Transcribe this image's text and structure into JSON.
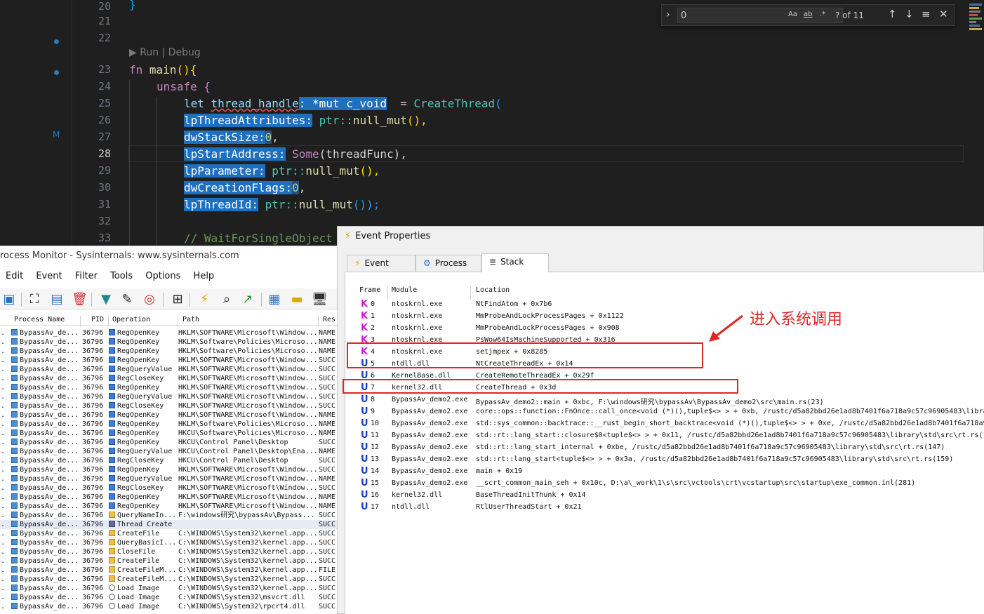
{
  "editor": {
    "line_numbers": [
      "20",
      "21",
      "22",
      "23",
      "24",
      "25",
      "26",
      "27",
      "28",
      "29",
      "30",
      "31",
      "32",
      "33"
    ],
    "active_line": "28",
    "codelens": "▶ Run | Debug",
    "gutter_marker": "M",
    "code": {
      "l20": "}",
      "l23_kw": "fn",
      "l23_fn": "main",
      "l23_rest": "(){",
      "l24_kw": "unsafe",
      "l24_rest": " {",
      "l25_let": "let",
      "l25_var": "thread_handle",
      "l25_type": ": *mut c_void",
      "l25_eq": "  = ",
      "l25_fn": "CreateThread",
      "l25_paren": "(",
      "l26_param": "lpThreadAttributes:",
      "l26_val_ns": " ptr::",
      "l26_val_fn": "null_mut",
      "l26_end": "(),",
      "l27_param": "dwStackSize:",
      "l27_num": "0",
      "l27_end": ",",
      "l28_param": "lpStartAddress:",
      "l28_some": " Some",
      "l28_arg": "(threadFunc)",
      "l28_end": ",",
      "l29_param": "lpParameter:",
      "l29_val_ns": " ptr::",
      "l29_val_fn": "null_mut",
      "l29_end": "(),",
      "l30_param": "dwCreationFlags:",
      "l30_num": "0",
      "l30_end": ",",
      "l31_param": "lpThreadId:",
      "l31_val_ns": " ptr::",
      "l31_val_fn": "null_mut",
      "l31_end": "());",
      "l33_comment": "// WaitForSingleObject"
    },
    "find": {
      "value": "0",
      "case_label": "Aa",
      "word_label": "ab",
      "regex_label": ".*",
      "count": "? of 11"
    }
  },
  "procmon": {
    "title": "rocess Monitor - Sysinternals: www.sysinternals.com",
    "menu": [
      "Edit",
      "Event",
      "Filter",
      "Tools",
      "Options",
      "Help"
    ],
    "columns": [
      "Process Name",
      "PID",
      "Operation",
      "Path",
      "Res"
    ],
    "rows": [
      {
        "proc": "BypassAv_de...",
        "pid": "36796",
        "op": "RegOpenKey",
        "path": "HKLM\\SOFTWARE\\Microsoft\\Window...",
        "res": "NAME",
        "kind": "reg"
      },
      {
        "proc": "BypassAv_de...",
        "pid": "36796",
        "op": "RegOpenKey",
        "path": "HKLM\\Software\\Policies\\Microso...",
        "res": "NAME",
        "kind": "reg"
      },
      {
        "proc": "BypassAv_de...",
        "pid": "36796",
        "op": "RegOpenKey",
        "path": "HKLM\\Software\\Policies\\Microso...",
        "res": "NAME",
        "kind": "reg"
      },
      {
        "proc": "BypassAv_de...",
        "pid": "36796",
        "op": "RegOpenKey",
        "path": "HKLM\\SOFTWARE\\Microsoft\\Window...",
        "res": "SUCC",
        "kind": "reg"
      },
      {
        "proc": "BypassAv_de...",
        "pid": "36796",
        "op": "RegQueryValue",
        "path": "HKLM\\SOFTWARE\\Microsoft\\Window...",
        "res": "SUCC",
        "kind": "reg"
      },
      {
        "proc": "BypassAv_de...",
        "pid": "36796",
        "op": "RegCloseKey",
        "path": "HKLM\\SOFTWARE\\Microsoft\\Window...",
        "res": "SUCC",
        "kind": "reg"
      },
      {
        "proc": "BypassAv_de...",
        "pid": "36796",
        "op": "RegOpenKey",
        "path": "HKLM\\SOFTWARE\\Microsoft\\Window...",
        "res": "SUCC",
        "kind": "reg"
      },
      {
        "proc": "BypassAv_de...",
        "pid": "36796",
        "op": "RegQueryValue",
        "path": "HKLM\\SOFTWARE\\Microsoft\\Window...",
        "res": "SUCC",
        "kind": "reg"
      },
      {
        "proc": "BypassAv_de...",
        "pid": "36796",
        "op": "RegCloseKey",
        "path": "HKLM\\SOFTWARE\\Microsoft\\Window...",
        "res": "SUCC",
        "kind": "reg"
      },
      {
        "proc": "BypassAv_de...",
        "pid": "36796",
        "op": "RegOpenKey",
        "path": "HKLM\\SOFTWARE\\Microsoft\\Window...",
        "res": "NAME",
        "kind": "reg"
      },
      {
        "proc": "BypassAv_de...",
        "pid": "36796",
        "op": "RegOpenKey",
        "path": "HKLM\\Software\\Policies\\Microso...",
        "res": "NAME",
        "kind": "reg"
      },
      {
        "proc": "BypassAv_de...",
        "pid": "36796",
        "op": "RegOpenKey",
        "path": "HKCU\\Software\\Policies\\Microso...",
        "res": "NAME",
        "kind": "reg"
      },
      {
        "proc": "BypassAv_de...",
        "pid": "36796",
        "op": "RegOpenKey",
        "path": "HKCU\\Control Panel\\Desktop",
        "res": "SUCC",
        "kind": "reg"
      },
      {
        "proc": "BypassAv_de...",
        "pid": "36796",
        "op": "RegQueryValue",
        "path": "HKCU\\Control Panel\\Desktop\\Ena...",
        "res": "NAME",
        "kind": "reg"
      },
      {
        "proc": "BypassAv_de...",
        "pid": "36796",
        "op": "RegCloseKey",
        "path": "HKCU\\Control Panel\\Desktop",
        "res": "SUCC",
        "kind": "reg"
      },
      {
        "proc": "BypassAv_de...",
        "pid": "36796",
        "op": "RegOpenKey",
        "path": "HKLM\\SOFTWARE\\Microsoft\\Window...",
        "res": "SUCC",
        "kind": "reg"
      },
      {
        "proc": "BypassAv_de...",
        "pid": "36796",
        "op": "RegQueryValue",
        "path": "HKLM\\SOFTWARE\\Microsoft\\Window...",
        "res": "NAME",
        "kind": "reg"
      },
      {
        "proc": "BypassAv_de...",
        "pid": "36796",
        "op": "RegCloseKey",
        "path": "HKLM\\SOFTWARE\\Microsoft\\Window...",
        "res": "SUCC",
        "kind": "reg"
      },
      {
        "proc": "BypassAv_de...",
        "pid": "36796",
        "op": "RegOpenKey",
        "path": "HKLM\\SOFTWARE\\Microsoft\\Window...",
        "res": "NAME",
        "kind": "reg"
      },
      {
        "proc": "BypassAv_de...",
        "pid": "36796",
        "op": "RegOpenKey",
        "path": "HKLM\\SOFTWARE\\Microsoft\\Window...",
        "res": "NAME",
        "kind": "reg"
      },
      {
        "proc": "BypassAv_de...",
        "pid": "36796",
        "op": "QueryNameIn...",
        "path": "F:\\windows研究\\bypassAv\\Bypass...",
        "res": "SUCC",
        "kind": "file"
      },
      {
        "proc": "BypassAv_de...",
        "pid": "36796",
        "op": "Thread Create",
        "path": "",
        "res": "SUCC",
        "kind": "thread",
        "selected": true
      },
      {
        "proc": "BypassAv_de...",
        "pid": "36796",
        "op": "CreateFile",
        "path": "C:\\WINDOWS\\System32\\kernel.app...",
        "res": "SUCC",
        "kind": "file"
      },
      {
        "proc": "BypassAv_de...",
        "pid": "36796",
        "op": "QueryBasicI...",
        "path": "C:\\WINDOWS\\System32\\kernel.app...",
        "res": "SUCC",
        "kind": "file"
      },
      {
        "proc": "BypassAv_de...",
        "pid": "36796",
        "op": "CloseFile",
        "path": "C:\\WINDOWS\\System32\\kernel.app...",
        "res": "SUCC",
        "kind": "file"
      },
      {
        "proc": "BypassAv_de...",
        "pid": "36796",
        "op": "CreateFile",
        "path": "C:\\WINDOWS\\System32\\kernel.app...",
        "res": "SUCC",
        "kind": "file"
      },
      {
        "proc": "BypassAv_de...",
        "pid": "36796",
        "op": "CreateFileM...",
        "path": "C:\\WINDOWS\\System32\\kernel.app...",
        "res": "FILE",
        "kind": "file"
      },
      {
        "proc": "BypassAv_de...",
        "pid": "36796",
        "op": "CreateFileM...",
        "path": "C:\\WINDOWS\\System32\\kernel.app...",
        "res": "SUCC",
        "kind": "file"
      },
      {
        "proc": "BypassAv_de...",
        "pid": "36796",
        "op": "Load Image",
        "path": "C:\\WINDOWS\\System32\\kernel.app...",
        "res": "SUCC",
        "kind": "img"
      },
      {
        "proc": "BypassAv_de...",
        "pid": "36796",
        "op": "Load Image",
        "path": "C:\\WINDOWS\\System32\\msvcrt.dll",
        "res": "SUCC",
        "kind": "img"
      },
      {
        "proc": "BypassAv_de...",
        "pid": "36796",
        "op": "Load Image",
        "path": "C:\\WINDOWS\\System32\\rpcrt4.dll",
        "res": "SUCC",
        "kind": "img"
      }
    ]
  },
  "event_properties": {
    "title": "Event Properties",
    "tabs": [
      "Event",
      "Process",
      "Stack"
    ],
    "active_tab": "Stack",
    "columns": [
      "Frame",
      "Module",
      "Location"
    ],
    "frames": [
      {
        "mode": "K",
        "frame": "0",
        "module": "ntoskrnl.exe",
        "location": "NtFindAtom + 0x7b6"
      },
      {
        "mode": "K",
        "frame": "1",
        "module": "ntoskrnl.exe",
        "location": "MmProbeAndLockProcessPages + 0x1122"
      },
      {
        "mode": "K",
        "frame": "2",
        "module": "ntoskrnl.exe",
        "location": "MmProbeAndLockProcessPages + 0x908"
      },
      {
        "mode": "K",
        "frame": "3",
        "module": "ntoskrnl.exe",
        "location": "PsWow64IsMachineSupported + 0x316"
      },
      {
        "mode": "K",
        "frame": "4",
        "module": "ntoskrnl.exe",
        "location": "setjmpex + 0x8285"
      },
      {
        "mode": "U",
        "frame": "5",
        "module": "ntdll.dll",
        "location": "NtCreateThreadEx + 0x14"
      },
      {
        "mode": "U",
        "frame": "6",
        "module": "KernelBase.dll",
        "location": "CreateRemoteThreadEx + 0x29f"
      },
      {
        "mode": "U",
        "frame": "7",
        "module": "kernel32.dll",
        "location": "CreateThread + 0x3d"
      },
      {
        "mode": "U",
        "frame": "8",
        "module": "BypassAv_demo2.exe",
        "location": "BypassAv_demo2::main + 0xbc, F:\\windows研究\\bypassAv\\BypassAv_demo2\\src\\main.rs(23)"
      },
      {
        "mode": "U",
        "frame": "9",
        "module": "BypassAv_demo2.exe",
        "location": "core::ops::function::FnOnce::call_once<void (*)(),tuple$<> > + 0xb, /rustc/d5a82bbd26e1ad8b7401f6a718a9c57c96905483\\libra"
      },
      {
        "mode": "U",
        "frame": "10",
        "module": "BypassAv_demo2.exe",
        "location": "std::sys_common::backtrace::__rust_begin_short_backtrace<void (*)(),tuple$<> > + 0xe, /rustc/d5a82bbd26e1ad8b7401f6a718a9"
      },
      {
        "mode": "U",
        "frame": "11",
        "module": "BypassAv_demo2.exe",
        "location": "std::rt::lang_start::closure$0<tuple$<> > + 0x11, /rustc/d5a82bbd26e1ad8b7401f6a718a9c57c96905483\\library\\std\\src\\rt.rs(1"
      },
      {
        "mode": "U",
        "frame": "12",
        "module": "BypassAv_demo2.exe",
        "location": "std::rt::lang_start_internal + 0xbe, /rustc/d5a82bbd26e1ad8b7401f6a718a9c57c96905483\\library\\std\\src\\rt.rs(147)"
      },
      {
        "mode": "U",
        "frame": "13",
        "module": "BypassAv_demo2.exe",
        "location": "std::rt::lang_start<tuple$<> > + 0x3a, /rustc/d5a82bbd26e1ad8b7401f6a718a9c57c96905483\\library\\std\\src\\rt.rs(159)"
      },
      {
        "mode": "U",
        "frame": "14",
        "module": "BypassAv_demo2.exe",
        "location": "main + 0x19"
      },
      {
        "mode": "U",
        "frame": "15",
        "module": "BypassAv_demo2.exe",
        "location": "__scrt_common_main_seh + 0x10c, D:\\a\\_work\\1\\s\\src\\vctools\\crt\\vcstartup\\src\\startup\\exe_common.inl(281)"
      },
      {
        "mode": "U",
        "frame": "16",
        "module": "kernel32.dll",
        "location": "BaseThreadInitThunk + 0x14"
      },
      {
        "mode": "U",
        "frame": "17",
        "module": "ntdll.dll",
        "location": "RtlUserThreadStart + 0x21"
      }
    ],
    "annotation": "进入系统调用"
  },
  "colors": {
    "kernel_mode": "#d41ad4",
    "user_mode": "#1a3fb8",
    "annotation": "#e02525",
    "selection": "#1f6fbf"
  }
}
